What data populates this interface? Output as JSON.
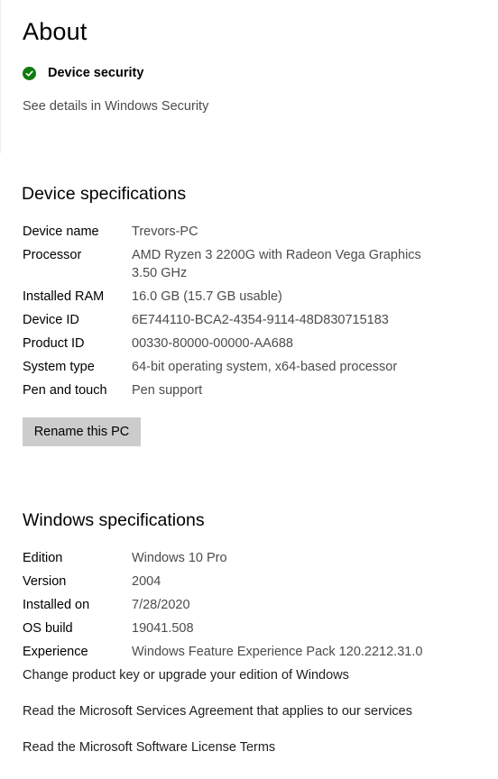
{
  "page": {
    "title": "About"
  },
  "security": {
    "label": "Device security",
    "icon": "check-circle-icon",
    "status_color": "#107c10",
    "details_link": "See details in Windows Security"
  },
  "device_specs": {
    "heading": "Device specifications",
    "rows": [
      {
        "label": "Device name",
        "value": "Trevors-PC"
      },
      {
        "label": "Processor",
        "value": "AMD Ryzen 3 2200G with Radeon Vega Graphics",
        "value_line2": "3.50 GHz"
      },
      {
        "label": "Installed RAM",
        "value": "16.0 GB (15.7 GB usable)"
      },
      {
        "label": "Device ID",
        "value": "6E744110-BCA2-4354-9114-48D830715183"
      },
      {
        "label": "Product ID",
        "value": "00330-80000-00000-AA688"
      },
      {
        "label": "System type",
        "value": "64-bit operating system, x64-based processor"
      },
      {
        "label": "Pen and touch",
        "value": "Pen support"
      }
    ],
    "rename_button": "Rename this PC"
  },
  "windows_specs": {
    "heading": "Windows specifications",
    "rows": [
      {
        "label": "Edition",
        "value": "Windows 10 Pro"
      },
      {
        "label": "Version",
        "value": "2004"
      },
      {
        "label": "Installed on",
        "value": "7/28/2020"
      },
      {
        "label": "OS build",
        "value": "19041.508"
      },
      {
        "label": "Experience",
        "value": "Windows Feature Experience Pack 120.2212.31.0"
      }
    ],
    "links": [
      "Change product key or upgrade your edition of Windows",
      "Read the Microsoft Services Agreement that applies to our services",
      "Read the Microsoft Software License Terms"
    ]
  }
}
